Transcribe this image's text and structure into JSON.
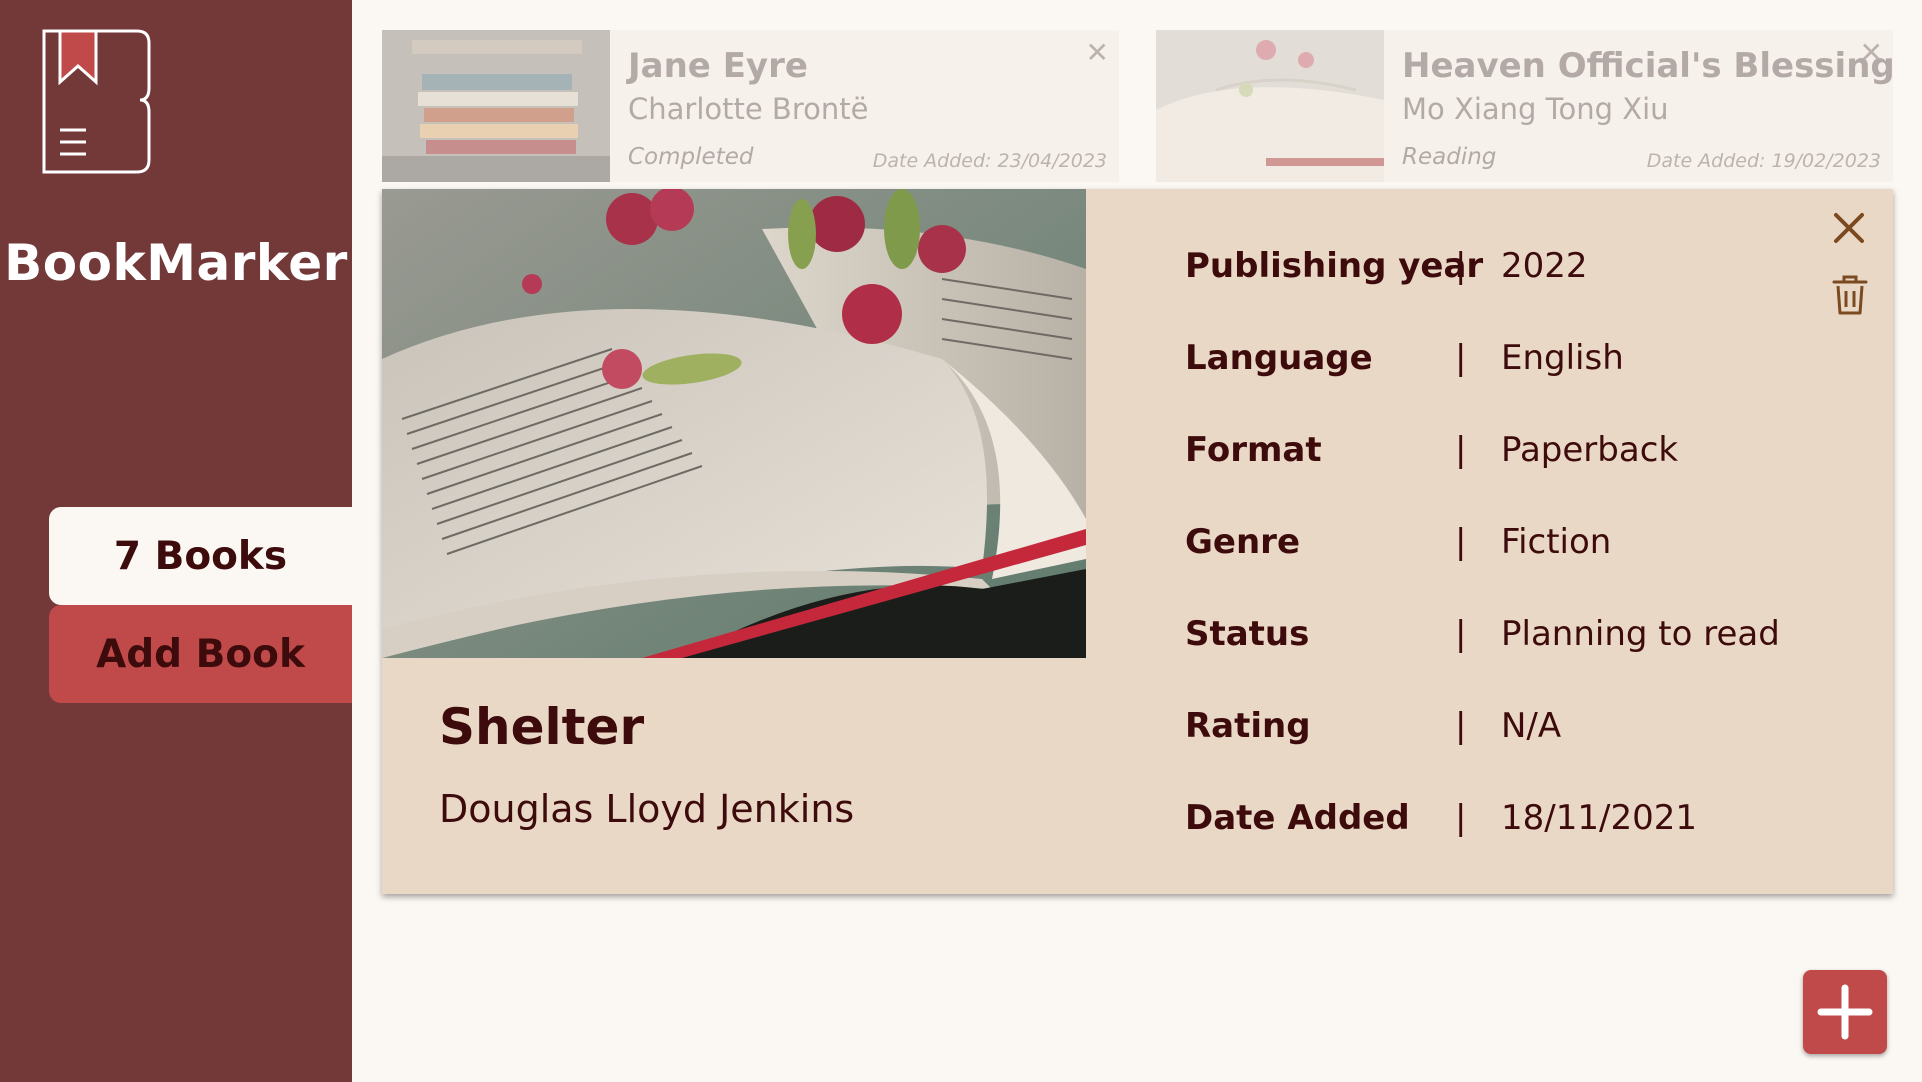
{
  "app": {
    "name": "BookMarker"
  },
  "sidebar": {
    "books_count_label": "7 Books",
    "add_book_label": "Add Book"
  },
  "background_cards": [
    {
      "title": "Jane Eyre",
      "author": "Charlotte Brontë",
      "status": "Completed",
      "date_added": "Date Added: 23/04/2023"
    },
    {
      "title": "Heaven Official's Blessing",
      "author": "Mo Xiang Tong Xiu",
      "status": "Reading",
      "date_added": "Date Added: 19/02/2023"
    }
  ],
  "detail": {
    "title": "Shelter",
    "author": "Douglas Lloyd Jenkins",
    "separator": "|",
    "properties": [
      {
        "label": "Publishing year",
        "value": "2022"
      },
      {
        "label": "Language",
        "value": "English"
      },
      {
        "label": "Format",
        "value": "Paperback"
      },
      {
        "label": "Genre",
        "value": "Fiction"
      },
      {
        "label": "Status",
        "value": "Planning to read"
      },
      {
        "label": "Rating",
        "value": "N/A"
      },
      {
        "label": "Date Added",
        "value": "18/11/2021"
      }
    ]
  },
  "colors": {
    "sidebar": "#733838",
    "accent": "#c04a4a",
    "panel": "#ead8c7",
    "text": "#3d0b0b",
    "background": "#fbf7f3"
  }
}
